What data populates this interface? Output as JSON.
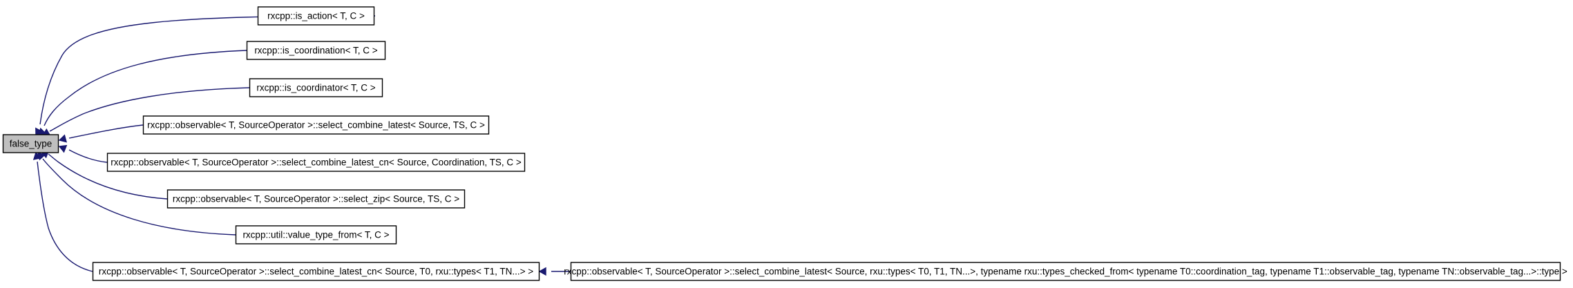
{
  "diagram": {
    "root": {
      "label": "false_type",
      "fill": "#bfbfbf"
    },
    "nodes": [
      {
        "id": "is_action",
        "label": "rxcpp::is_action< T, C >"
      },
      {
        "id": "is_coordination",
        "label": "rxcpp::is_coordination< T, C >"
      },
      {
        "id": "is_coordinator",
        "label": "rxcpp::is_coordinator< T, C >"
      },
      {
        "id": "select_combine_latest",
        "label": "rxcpp::observable< T, SourceOperator >::select_combine_latest< Source, TS, C >"
      },
      {
        "id": "select_combine_latest_cn",
        "label": "rxcpp::observable< T, SourceOperator >::select_combine_latest_cn< Source, Coordination, TS, C >"
      },
      {
        "id": "select_zip",
        "label": "rxcpp::observable< T, SourceOperator >::select_zip< Source, TS, C >"
      },
      {
        "id": "value_type_from",
        "label": "rxcpp::util::value_type_from< T, C >"
      },
      {
        "id": "select_combine_latest_cn_types",
        "label": "rxcpp::observable< T, SourceOperator >::select_combine_latest_cn< Source, T0, rxu::types< T1, TN...> >"
      },
      {
        "id": "select_combine_latest_types_checked",
        "label": "rxcpp::observable< T, SourceOperator >::select_combine_latest< Source, rxu::types< T0, T1, TN...>, typename rxu::types_checked_from< typename T0::coordination_tag, typename T1::observable_tag, typename TN::observable_tag...>::type >"
      }
    ],
    "edges": [
      {
        "from": "is_action",
        "to": "root"
      },
      {
        "from": "is_coordination",
        "to": "root"
      },
      {
        "from": "is_coordinator",
        "to": "root"
      },
      {
        "from": "select_combine_latest",
        "to": "root"
      },
      {
        "from": "select_combine_latest_cn",
        "to": "root"
      },
      {
        "from": "select_zip",
        "to": "root"
      },
      {
        "from": "value_type_from",
        "to": "root"
      },
      {
        "from": "select_combine_latest_cn_types",
        "to": "root"
      },
      {
        "from": "select_combine_latest_types_checked",
        "to": "select_combine_latest_cn_types"
      }
    ],
    "colors": {
      "edge": "#191970",
      "node_border": "#000000",
      "node_fill": "#ffffff",
      "root_fill": "#bfbfbf"
    }
  }
}
